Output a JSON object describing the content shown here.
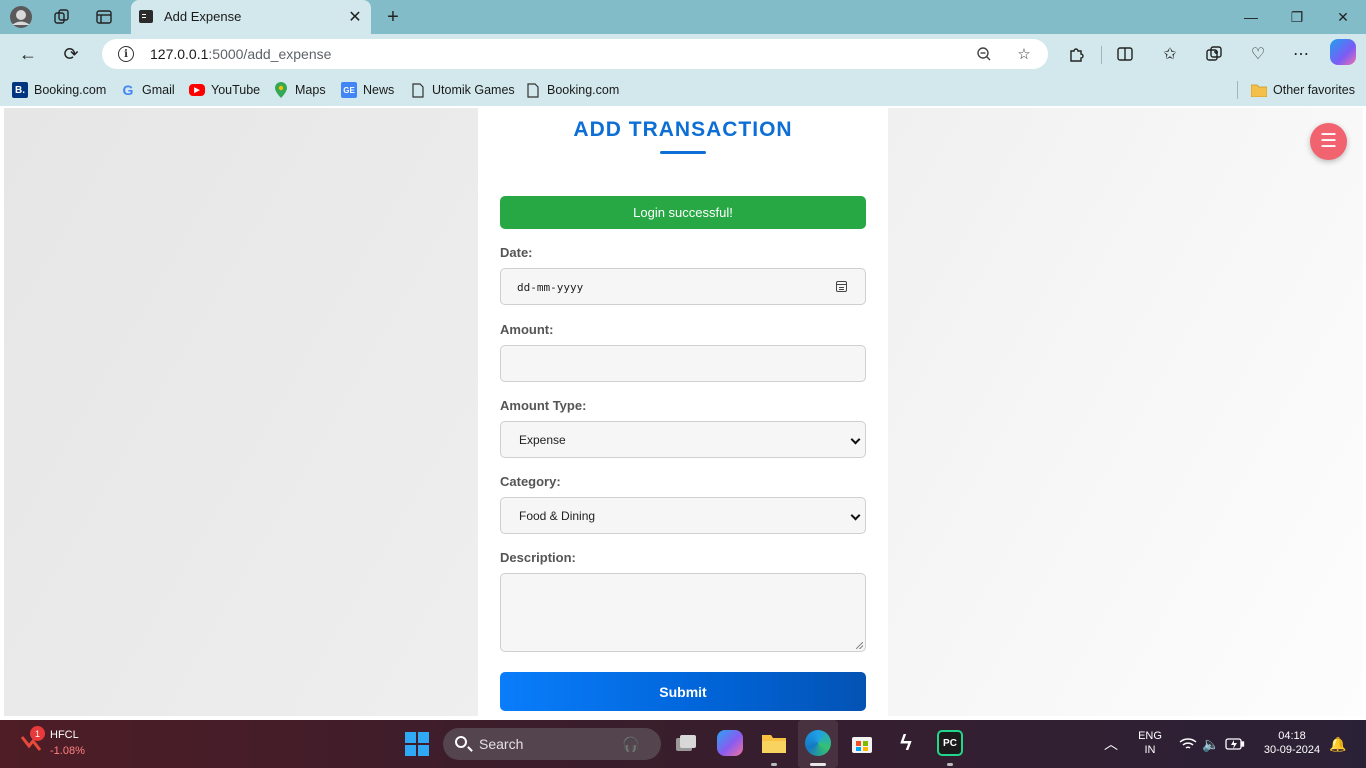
{
  "browser": {
    "tab": {
      "title": "Add Expense"
    },
    "address": {
      "host": "127.0.0.1",
      "path": ":5000/add_expense"
    },
    "favorites": [
      {
        "label": "Booking.com",
        "icon": "booking-icon"
      },
      {
        "label": "Gmail",
        "icon": "google-icon"
      },
      {
        "label": "YouTube",
        "icon": "youtube-icon"
      },
      {
        "label": "Maps",
        "icon": "maps-icon"
      },
      {
        "label": "News",
        "icon": "news-icon"
      },
      {
        "label": "Utomik Games",
        "icon": "page-icon"
      },
      {
        "label": "Booking.com",
        "icon": "page-icon"
      }
    ],
    "other_favorites": "Other favorites"
  },
  "page": {
    "heading": "ADD TRANSACTION",
    "alert": "Login successful!",
    "fields": {
      "date": {
        "label": "Date:",
        "placeholder": "dd-mm-yyyy"
      },
      "amount": {
        "label": "Amount:",
        "value": ""
      },
      "amount_type": {
        "label": "Amount Type:",
        "selected": "Expense"
      },
      "category": {
        "label": "Category:",
        "selected": "Food & Dining"
      },
      "description": {
        "label": "Description:",
        "value": ""
      }
    },
    "submit_label": "Submit",
    "menu_icon": "menu-icon"
  },
  "colors": {
    "heading": "#0d6fd6",
    "alert_bg": "#28a745",
    "submit_bg": "#0a7dfb",
    "menu_fab": "#f0636f",
    "browser_frame": "#83bcc9"
  },
  "taskbar": {
    "stock": {
      "name": "HFCL",
      "change": "-1.08%",
      "badge": "1"
    },
    "search_placeholder": "Search",
    "language": {
      "line1": "ENG",
      "line2": "IN"
    },
    "clock": {
      "time": "04:18",
      "date": "30-09-2024"
    }
  }
}
